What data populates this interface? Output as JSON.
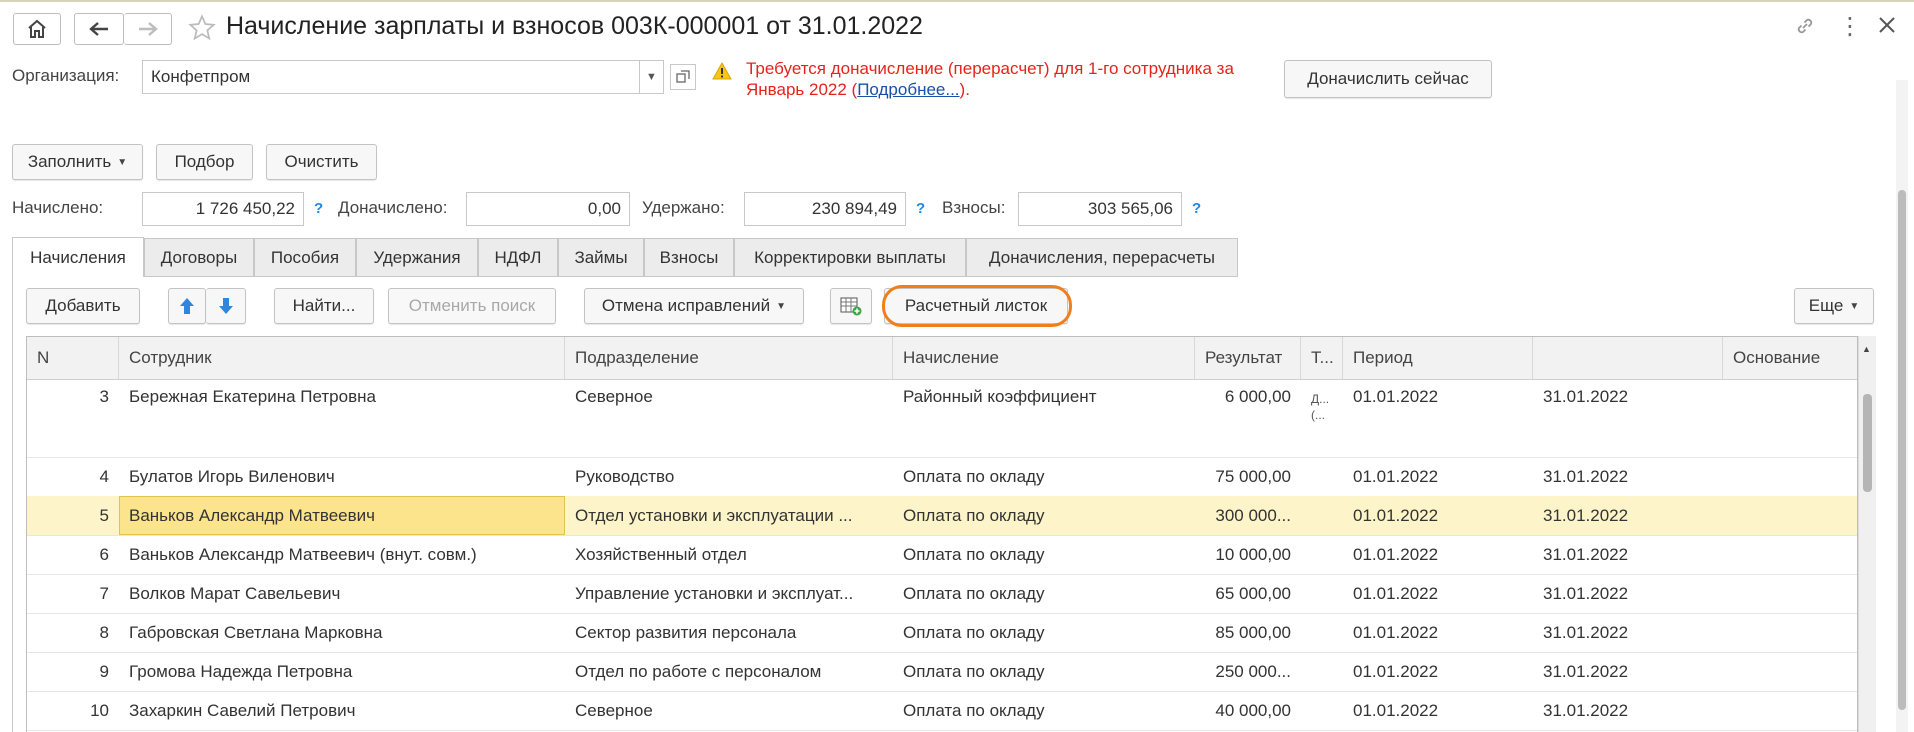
{
  "window": {
    "title": "Начисление зарплаты и взносов 003К-000001 от 31.01.2022"
  },
  "org": {
    "label": "Организация:",
    "value": "Конфетпром"
  },
  "warning": {
    "line1": "Требуется доначисление (перерасчет) для 1-го сотрудника за",
    "line2_prefix": "Январь 2022 (",
    "link": "Подробнее...",
    "line2_suffix": ")."
  },
  "buttons": {
    "recalc_now": "Доначислить сейчас",
    "fill": "Заполнить",
    "pick": "Подбор",
    "clear": "Очистить",
    "add": "Добавить",
    "find": "Найти...",
    "cancel_search": "Отменить поиск",
    "cancel_fixes": "Отмена исправлений",
    "payslip": "Расчетный листок",
    "more": "Еще"
  },
  "totals": {
    "accrued_label": "Начислено:",
    "accrued_value": "1 726 450,22",
    "extra_label": "Доначислено:",
    "extra_value": "0,00",
    "withheld_label": "Удержано:",
    "withheld_value": "230 894,49",
    "contrib_label": "Взносы:",
    "contrib_value": "303 565,06",
    "help": "?"
  },
  "tabs": [
    {
      "label": "Начисления"
    },
    {
      "label": "Договоры"
    },
    {
      "label": "Пособия"
    },
    {
      "label": "Удержания"
    },
    {
      "label": "НДФЛ"
    },
    {
      "label": "Займы"
    },
    {
      "label": "Взносы"
    },
    {
      "label": "Корректировки выплаты"
    },
    {
      "label": "Доначисления, перерасчеты"
    }
  ],
  "table": {
    "columns": [
      "N",
      "Сотрудник",
      "Подразделение",
      "Начисление",
      "Результат",
      "Т...",
      "Период",
      "",
      "Основание"
    ],
    "rows": [
      {
        "n": "3",
        "employee": "Бережная Екатерина Петровна",
        "dept": "Северное",
        "accrual": "Районный коэффициент",
        "result": "6 000,00",
        "t1": "Д...",
        "t2": "(...",
        "from": "01.01.2022",
        "to": "31.01.2022",
        "basis": ""
      },
      {
        "n": "4",
        "employee": "Булатов Игорь Виленович",
        "dept": "Руководство",
        "accrual": "Оплата по окладу",
        "result": "75 000,00",
        "t1": "",
        "t2": "",
        "from": "01.01.2022",
        "to": "31.01.2022",
        "basis": ""
      },
      {
        "n": "5",
        "employee": "Ваньков Александр Матвеевич",
        "dept": "Отдел установки и эксплуатации ...",
        "accrual": "Оплата по окладу",
        "result": "300 000...",
        "t1": "",
        "t2": "",
        "from": "01.01.2022",
        "to": "31.01.2022",
        "basis": ""
      },
      {
        "n": "6",
        "employee": "Ваньков Александр Матвеевич (внут. совм.)",
        "dept": "Хозяйственный отдел",
        "accrual": "Оплата по окладу",
        "result": "10 000,00",
        "t1": "",
        "t2": "",
        "from": "01.01.2022",
        "to": "31.01.2022",
        "basis": ""
      },
      {
        "n": "7",
        "employee": "Волков Марат Савельевич",
        "dept": "Управление установки и эксплуат...",
        "accrual": "Оплата по окладу",
        "result": "65 000,00",
        "t1": "",
        "t2": "",
        "from": "01.01.2022",
        "to": "31.01.2022",
        "basis": ""
      },
      {
        "n": "8",
        "employee": "Габровская Светлана Марковна",
        "dept": "Сектор развития персонала",
        "accrual": "Оплата по окладу",
        "result": "85 000,00",
        "t1": "",
        "t2": "",
        "from": "01.01.2022",
        "to": "31.01.2022",
        "basis": ""
      },
      {
        "n": "9",
        "employee": "Громова Надежда Петровна",
        "dept": "Отдел по работе с персоналом",
        "accrual": "Оплата по окладу",
        "result": "250 000...",
        "t1": "",
        "t2": "",
        "from": "01.01.2022",
        "to": "31.01.2022",
        "basis": ""
      },
      {
        "n": "10",
        "employee": "Захаркин Савелий Петрович",
        "dept": "Северное",
        "accrual": "Оплата по окладу",
        "result": "40 000,00",
        "t1": "",
        "t2": "",
        "from": "01.01.2022",
        "to": "31.01.2022",
        "basis": ""
      }
    ]
  },
  "colors": {
    "highlight": "#f07f1b",
    "warning": "#e5231b",
    "selected_row": "#fdf5c9",
    "active_cell": "#fbe48c",
    "help": "#1e88e5"
  }
}
